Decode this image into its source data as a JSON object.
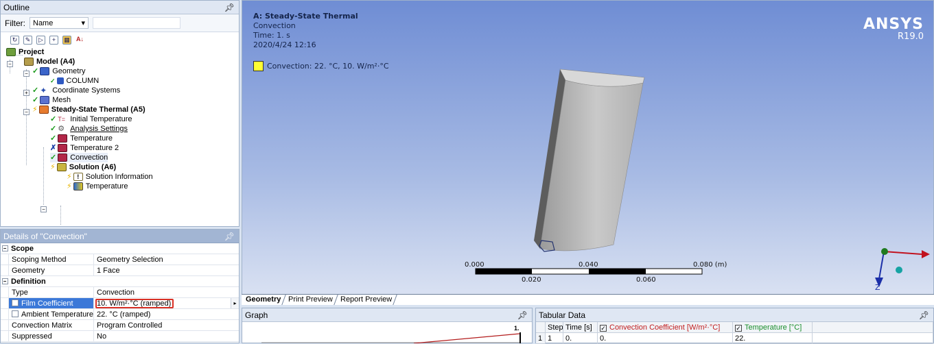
{
  "outline": {
    "title": "Outline",
    "pin": "∘",
    "filter_label": "Filter:",
    "filter_value": "Name",
    "tree": [
      {
        "label": "Project",
        "bold": true
      },
      {
        "label": "Model (A4)",
        "bold": true
      },
      {
        "label": "Geometry"
      },
      {
        "label": "COLUMN"
      },
      {
        "label": "Coordinate Systems"
      },
      {
        "label": "Mesh"
      },
      {
        "label": "Steady-State Thermal (A5)",
        "bold": true
      },
      {
        "label": "Initial Temperature"
      },
      {
        "label": "Analysis Settings"
      },
      {
        "label": "Temperature"
      },
      {
        "label": "Temperature 2"
      },
      {
        "label": "Convection"
      },
      {
        "label": "Solution (A6)",
        "bold": true
      },
      {
        "label": "Solution Information"
      },
      {
        "label": "Temperature"
      }
    ]
  },
  "details": {
    "title": "Details of \"Convection\"",
    "pin": "∘",
    "groups": {
      "scope": "Scope",
      "definition": "Definition"
    },
    "rows": {
      "scoping_method": {
        "key": "Scoping Method",
        "value": "Geometry Selection"
      },
      "geometry": {
        "key": "Geometry",
        "value": "1 Face"
      },
      "type": {
        "key": "Type",
        "value": "Convection"
      },
      "film_coefficient": {
        "key": "Film Coefficient",
        "value": "10. W/m²·°C  (ramped)"
      },
      "ambient_temperature": {
        "key": "Ambient Temperature",
        "value": "22. °C  (ramped)"
      },
      "convection_matrix": {
        "key": "Convection Matrix",
        "value": "Program Controlled"
      },
      "suppressed": {
        "key": "Suppressed",
        "value": "No"
      }
    }
  },
  "viewport": {
    "analysis": "A: Steady-State Thermal",
    "object": "Convection",
    "time": "Time: 1. s",
    "date": "2020/4/24 12:16",
    "legend": "Convection: 22. °C, 10. W/m²·°C",
    "logo": "ANSYS",
    "version": "R19.0",
    "scale": {
      "top": [
        "0.000",
        "0.040",
        "0.080 (m)"
      ],
      "bottom": [
        "0.020",
        "0.060"
      ]
    },
    "axis_z": "Z"
  },
  "tabs": [
    "Geometry",
    "Print Preview",
    "Report Preview"
  ],
  "graph": {
    "title": "Graph",
    "pin": "∘",
    "ytick": "1."
  },
  "tabular": {
    "title": "Tabular Data",
    "pin": "∘",
    "headers": [
      "",
      "Steps",
      "Time [s]",
      "Convection Coefficient [W/m²·°C]",
      "Temperature [°C]"
    ],
    "row": [
      "1",
      "1",
      "0.",
      "0.",
      "22."
    ]
  },
  "colors": {
    "selection": "#3b78d8",
    "highlight_box": "#d93025",
    "legend_swatch": "#ffff33"
  }
}
